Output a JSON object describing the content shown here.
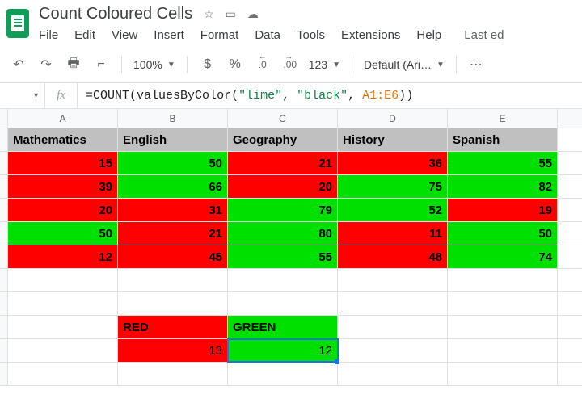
{
  "doc": {
    "title": "Count Coloured Cells"
  },
  "menu": {
    "file": "File",
    "edit": "Edit",
    "view": "View",
    "insert": "Insert",
    "format": "Format",
    "data": "Data",
    "tools": "Tools",
    "extensions": "Extensions",
    "help": "Help",
    "last_edit": "Last ed"
  },
  "toolbar": {
    "zoom": "100%",
    "currency": "$",
    "percent": "%",
    "dec_dec": ".0",
    "inc_dec": ".00",
    "num_fmt": "123",
    "font": "Default (Ari…"
  },
  "formula": {
    "prefix": "=",
    "fn": "COUNT",
    "open": "(",
    "inner_fn": "valuesByColor",
    "open2": "(",
    "arg1": "\"lime\"",
    "comma1": ", ",
    "arg2": "\"black\"",
    "comma2": ", ",
    "ref": "A1:E6",
    "close2": ")",
    "close": ")"
  },
  "cols": {
    "A": "A",
    "B": "B",
    "C": "C",
    "D": "D",
    "E": "E"
  },
  "headers": {
    "A": "Mathematics",
    "B": "English",
    "C": "Geography",
    "D": "History",
    "E": "Spanish"
  },
  "rows": [
    {
      "A": {
        "v": "15",
        "c": "red"
      },
      "B": {
        "v": "50",
        "c": "grn"
      },
      "C": {
        "v": "21",
        "c": "red"
      },
      "D": {
        "v": "36",
        "c": "red"
      },
      "E": {
        "v": "55",
        "c": "grn"
      }
    },
    {
      "A": {
        "v": "39",
        "c": "red"
      },
      "B": {
        "v": "66",
        "c": "grn"
      },
      "C": {
        "v": "20",
        "c": "red"
      },
      "D": {
        "v": "75",
        "c": "grn"
      },
      "E": {
        "v": "82",
        "c": "grn"
      }
    },
    {
      "A": {
        "v": "20",
        "c": "red"
      },
      "B": {
        "v": "31",
        "c": "red"
      },
      "C": {
        "v": "79",
        "c": "grn"
      },
      "D": {
        "v": "52",
        "c": "grn"
      },
      "E": {
        "v": "19",
        "c": "red"
      }
    },
    {
      "A": {
        "v": "50",
        "c": "grn"
      },
      "B": {
        "v": "21",
        "c": "red"
      },
      "C": {
        "v": "80",
        "c": "grn"
      },
      "D": {
        "v": "11",
        "c": "red"
      },
      "E": {
        "v": "50",
        "c": "grn"
      }
    },
    {
      "A": {
        "v": "12",
        "c": "red"
      },
      "B": {
        "v": "45",
        "c": "red"
      },
      "C": {
        "v": "55",
        "c": "grn"
      },
      "D": {
        "v": "48",
        "c": "red"
      },
      "E": {
        "v": "74",
        "c": "grn"
      }
    }
  ],
  "summary": {
    "red_label": "RED",
    "green_label": "GREEN",
    "red_count": "13",
    "green_count": "12"
  },
  "chart_data": {
    "type": "table",
    "title": "Count Coloured Cells",
    "columns": [
      "Mathematics",
      "English",
      "Geography",
      "History",
      "Spanish"
    ],
    "values": [
      [
        15,
        50,
        21,
        36,
        55
      ],
      [
        39,
        66,
        20,
        75,
        82
      ],
      [
        20,
        31,
        79,
        52,
        19
      ],
      [
        50,
        21,
        80,
        11,
        50
      ],
      [
        12,
        45,
        55,
        48,
        74
      ]
    ],
    "cell_colors": [
      [
        "red",
        "green",
        "red",
        "red",
        "green"
      ],
      [
        "red",
        "green",
        "red",
        "green",
        "green"
      ],
      [
        "red",
        "red",
        "green",
        "green",
        "red"
      ],
      [
        "green",
        "red",
        "green",
        "red",
        "green"
      ],
      [
        "red",
        "red",
        "green",
        "red",
        "green"
      ]
    ],
    "counts": {
      "RED": 13,
      "GREEN": 12
    }
  }
}
